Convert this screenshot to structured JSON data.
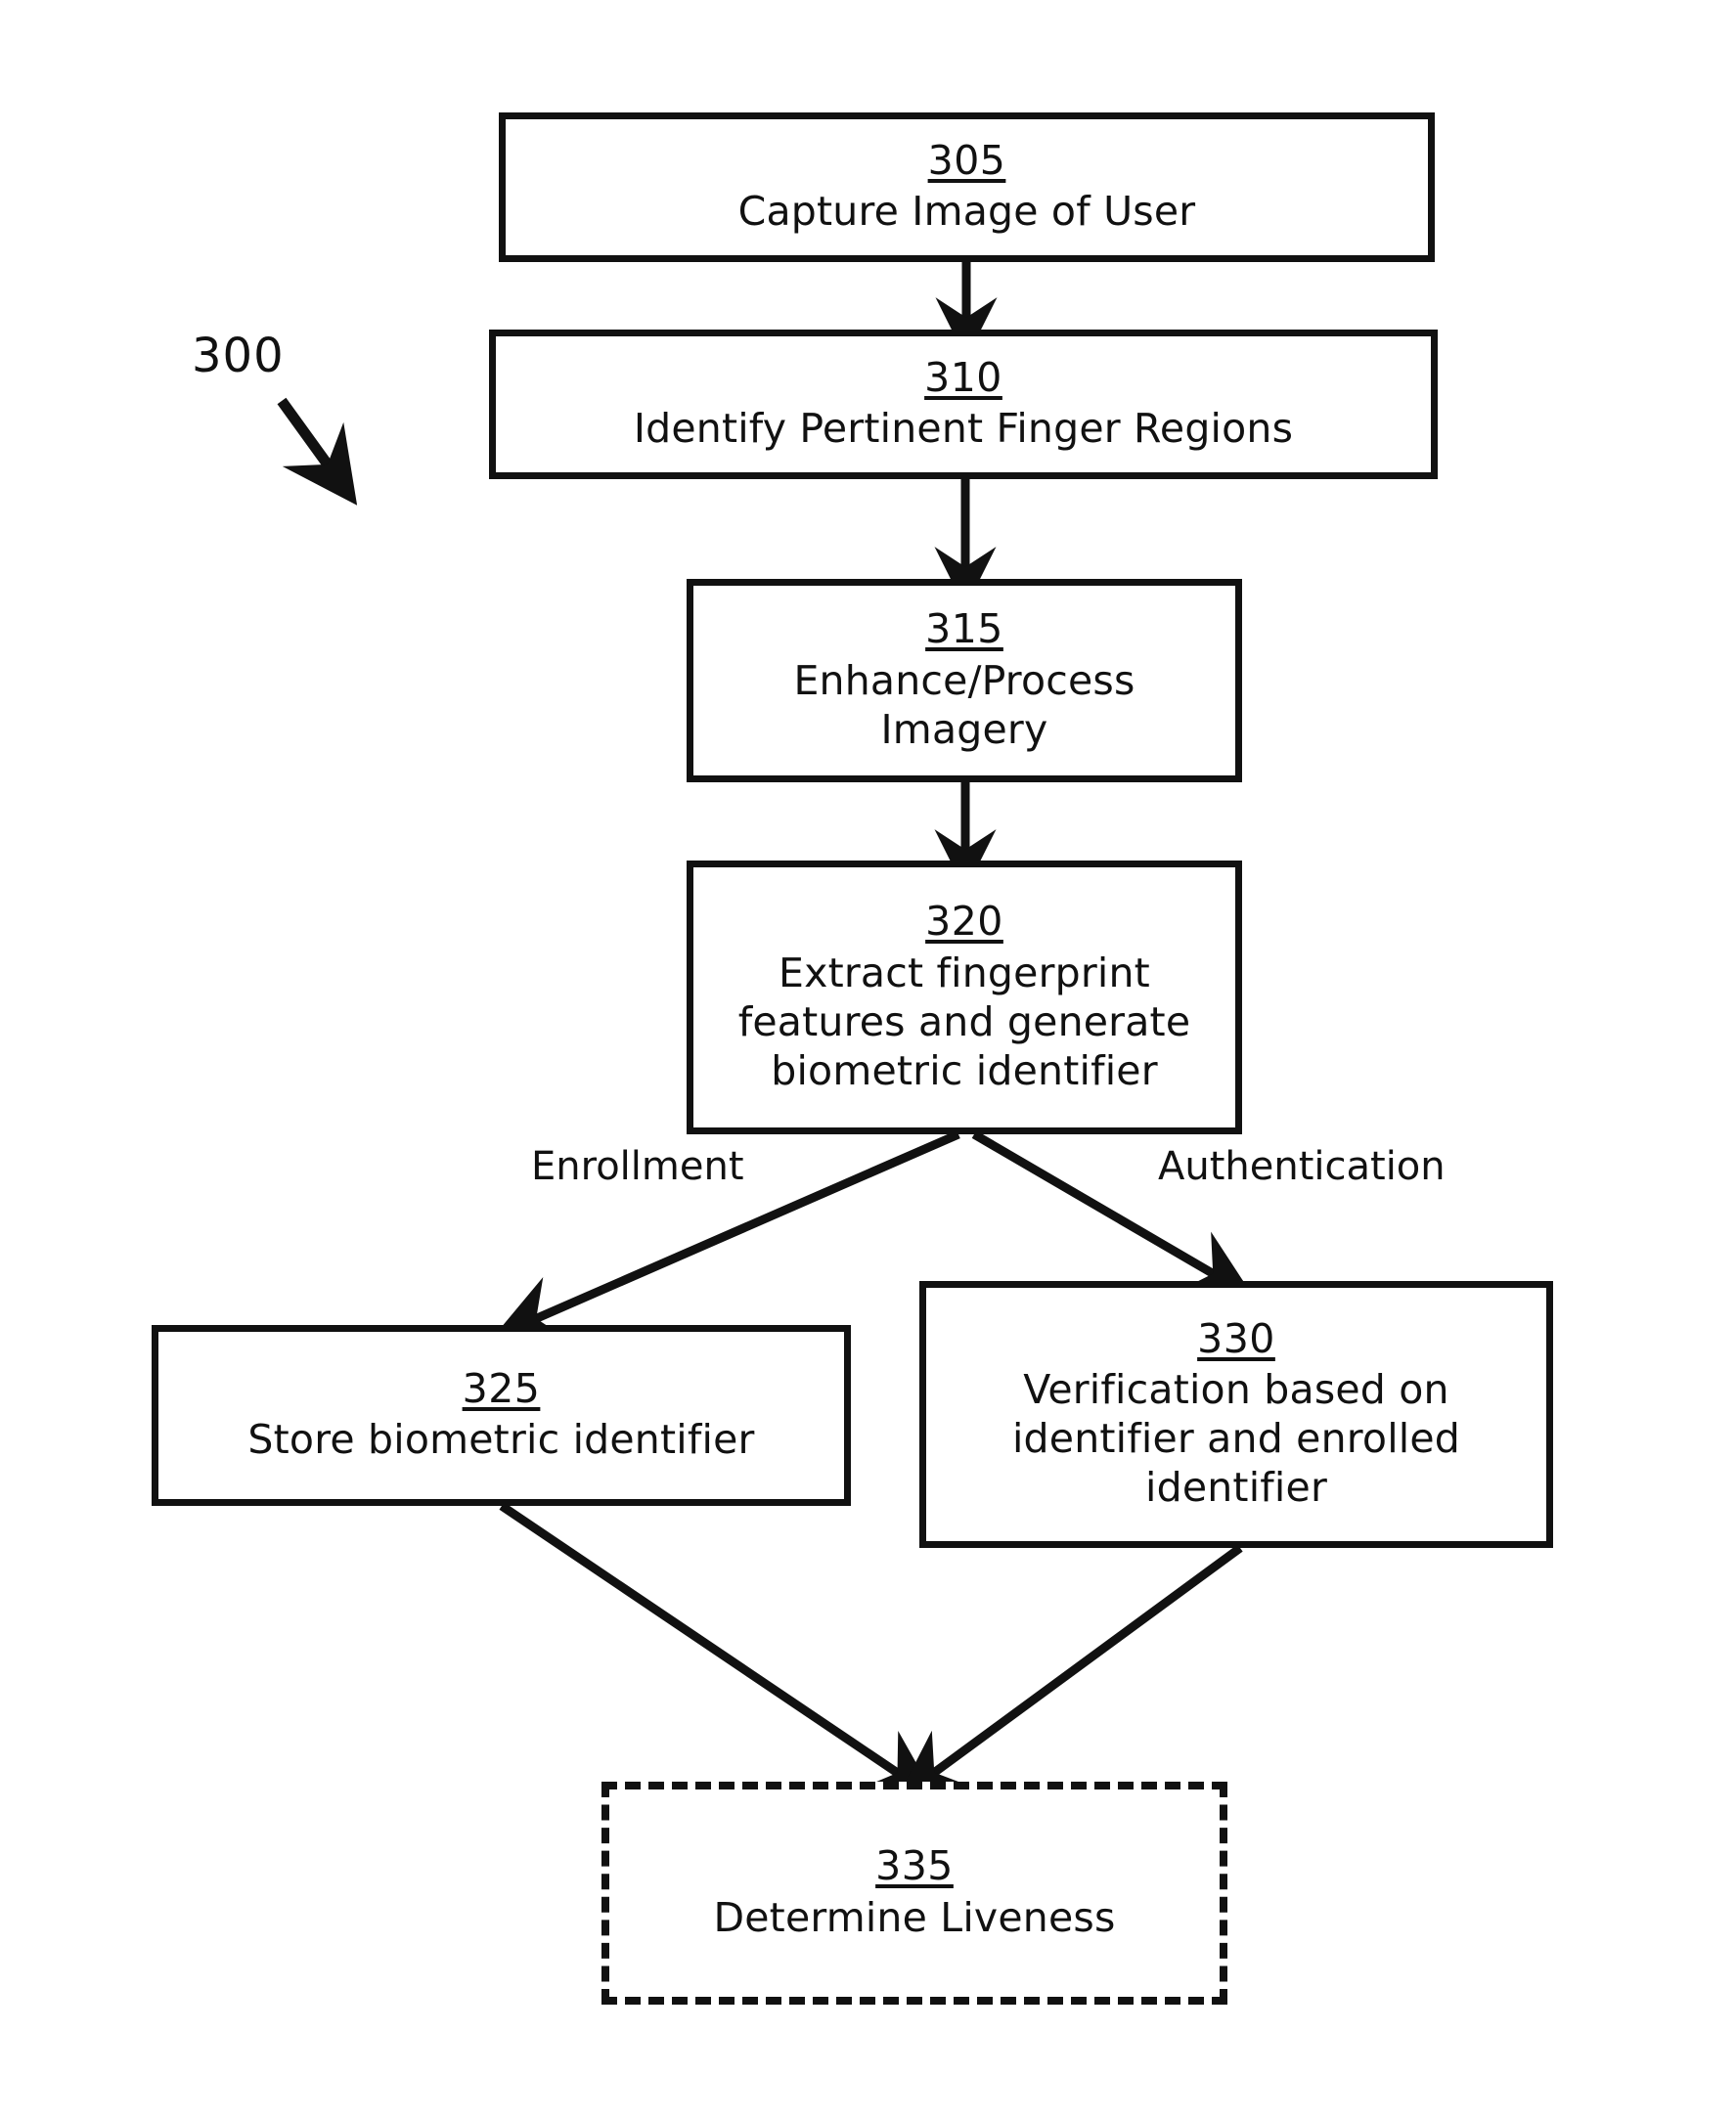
{
  "figure": {
    "reference_numeral": "300",
    "pointer_icon": "diagonal-arrow-down-right"
  },
  "nodes": [
    {
      "id": "305",
      "ref": "305",
      "label": "Capture Image of User",
      "border": "solid"
    },
    {
      "id": "310",
      "ref": "310",
      "label": "Identify Pertinent Finger Regions",
      "border": "solid"
    },
    {
      "id": "315",
      "ref": "315",
      "label": "Enhance/Process\nImagery",
      "border": "solid"
    },
    {
      "id": "320",
      "ref": "320",
      "label": "Extract fingerprint\nfeatures and generate\nbiometric identifier",
      "border": "solid"
    },
    {
      "id": "325",
      "ref": "325",
      "label": "Store biometric identifier",
      "border": "solid"
    },
    {
      "id": "330",
      "ref": "330",
      "label": "Verification based on\nidentifier and enrolled\nidentifier",
      "border": "solid"
    },
    {
      "id": "335",
      "ref": "335",
      "label": "Determine Liveness",
      "border": "dashed"
    }
  ],
  "edge_labels": {
    "enrollment": "Enrollment",
    "authentication": "Authentication"
  },
  "colors": {
    "stroke": "#111111",
    "background": "#ffffff"
  }
}
